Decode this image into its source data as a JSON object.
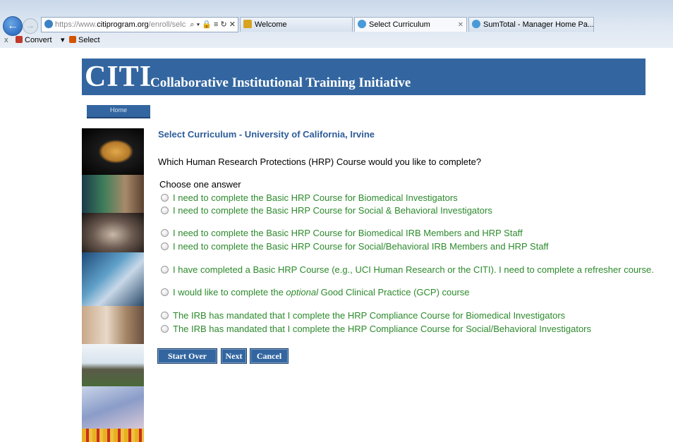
{
  "browser": {
    "address": {
      "prefix": "https://www.",
      "host": "citiprogram.org",
      "path": "/enroll/selc",
      "controls": "⌕ ▾ 🔒 ≡ ↻ ✕"
    },
    "tabs": [
      {
        "label": "Welcome",
        "icon_color": "#d8a320"
      },
      {
        "label": "Select Curriculum",
        "icon_color": "#4a9ad8"
      },
      {
        "label": "SumTotal - Manager Home Pa...",
        "icon_color": "#4a9ad8"
      }
    ],
    "tab_close": "✕",
    "command_bar": {
      "close": "x",
      "convert": "Convert",
      "convert_caret": "▾",
      "select": "Select"
    }
  },
  "banner": {
    "logo": "CITI",
    "subtitle": "Collaborative Institutional Training Initiative"
  },
  "nav": {
    "home": "Home"
  },
  "main": {
    "heading": "Select Curriculum - University of California, Irvine",
    "question": "Which Human Research Protections (HRP) Course would you like to complete?",
    "choose_label": "Choose one answer",
    "options": [
      {
        "text": "I need to complete the Basic HRP Course for Biomedical Investigators"
      },
      {
        "text": "I need to complete the Basic HRP Course for Social & Behavioral Investigators"
      },
      {
        "text": "I need to complete the Basic HRP Course for Biomedical IRB Members and HRP Staff"
      },
      {
        "text": "I need to complete the Basic HRP Course for Social/Behavioral IRB Members and HRP Staff"
      },
      {
        "text": "I have completed a Basic HRP Course (e.g., UCI Human Research or the CITI). I need to complete a refresher course."
      },
      {
        "text_before": "I would like to complete the ",
        "text_italic": "optional",
        "text_after": " Good Clinical Practice (GCP) course"
      },
      {
        "text": "The IRB has mandated that I complete the HRP Compliance Course for Biomedical Investigators"
      },
      {
        "text": "The IRB has mandated that I complete the HRP Compliance Course for Social/Behavioral Investigators"
      }
    ],
    "buttons": {
      "start_over": "Start Over",
      "next": "Next",
      "cancel": "Cancel"
    }
  },
  "colors": {
    "brand_blue": "#3366a0",
    "option_green": "#2c8a2c",
    "heading_blue": "#2e5d9a"
  }
}
